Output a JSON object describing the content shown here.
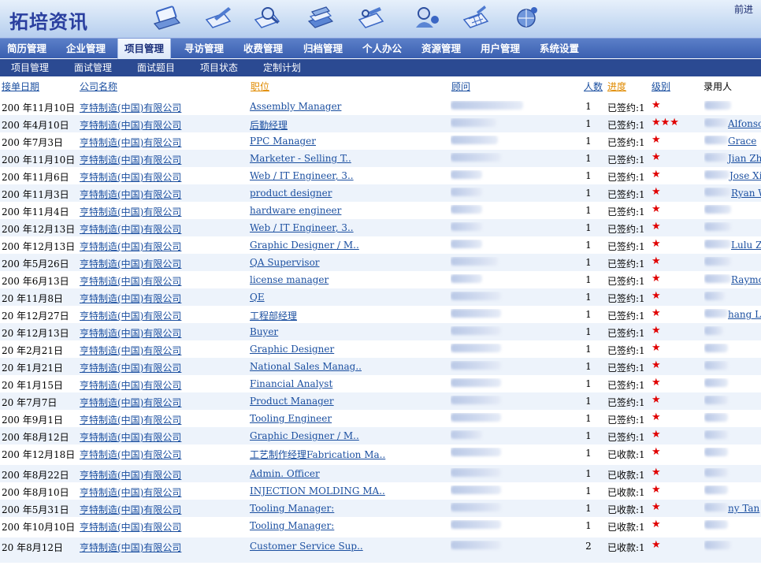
{
  "app": {
    "title": "拓培资讯",
    "top_link": "前进"
  },
  "top_icons": [
    "laptop-icon",
    "pen-document-icon",
    "search-document-icon",
    "books-icon",
    "document-tools-icon",
    "user-settings-icon",
    "calendar-icon",
    "globe-person-icon"
  ],
  "main_nav": [
    {
      "label": "简历管理"
    },
    {
      "label": "企业管理"
    },
    {
      "label": "项目管理"
    },
    {
      "label": "寻访管理"
    },
    {
      "label": "收费管理"
    },
    {
      "label": "归档管理"
    },
    {
      "label": "个人办公"
    },
    {
      "label": "资源管理"
    },
    {
      "label": "用户管理"
    },
    {
      "label": "系统设置"
    }
  ],
  "sub_nav": [
    {
      "label": "项目管理"
    },
    {
      "label": "面试管理"
    },
    {
      "label": "面试题目"
    },
    {
      "label": "项目状态"
    },
    {
      "label": "定制计划"
    }
  ],
  "columns": {
    "date": "接单日期",
    "company": "公司名称",
    "position": "职位",
    "consultant": "顾问",
    "count": "人数",
    "progress": "进度",
    "level": "级别",
    "recruiter": "录用人"
  },
  "rows": [
    {
      "date": "200 年11月10日",
      "company": "亨特制造(中国)有限公司",
      "position": "Assembly Manager",
      "count": "1",
      "status": "已签约:1",
      "level": "★",
      "recruiter": ""
    },
    {
      "date": "200 年4月10日",
      "company": "亨特制造(中国)有限公司",
      "position": "后勤经理",
      "count": "1",
      "status": "已签约:1",
      "level": "★★★",
      "recruiter": "Alfonso"
    },
    {
      "date": "200 年7月3日",
      "company": "亨特制造(中国)有限公司",
      "position": "PPC Manager",
      "count": "1",
      "status": "已签约:1",
      "level": "★",
      "recruiter": "Grace"
    },
    {
      "date": "200 年11月10日",
      "company": "亨特制造(中国)有限公司",
      "position": "Marketer - Selling T..",
      "count": "1",
      "status": "已签约:1",
      "level": "★",
      "recruiter": "Jian Zh"
    },
    {
      "date": "200 年11月6日",
      "company": "亨特制造(中国)有限公司",
      "position": "Web / IT Engineer, 3..",
      "count": "1",
      "status": "已签约:1",
      "level": "★",
      "recruiter": "Jose Xi"
    },
    {
      "date": "200 年11月3日",
      "company": "亨特制造(中国)有限公司",
      "position": "product designer",
      "count": "1",
      "status": "已签约:1",
      "level": "★",
      "recruiter": "Ryan W"
    },
    {
      "date": "200 年11月4日",
      "company": "亨特制造(中国)有限公司",
      "position": "hardware engineer",
      "count": "1",
      "status": "已签约:1",
      "level": "★",
      "recruiter": ""
    },
    {
      "date": "200 年12月13日",
      "company": "亨特制造(中国)有限公司",
      "position": "Web / IT Engineer, 3..",
      "count": "1",
      "status": "已签约:1",
      "level": "★",
      "recruiter": ""
    },
    {
      "date": "200 年12月13日",
      "company": "亨特制造(中国)有限公司",
      "position": "Graphic Designer / M..",
      "count": "1",
      "status": "已签约:1",
      "level": "★",
      "recruiter": "Lulu Zh"
    },
    {
      "date": "200 年5月26日",
      "company": "亨特制造(中国)有限公司",
      "position": "QA Supervisor",
      "count": "1",
      "status": "已签约:1",
      "level": "★",
      "recruiter": ""
    },
    {
      "date": "200 年6月13日",
      "company": "亨特制造(中国)有限公司",
      "position": "license manager",
      "count": "1",
      "status": "已签约:1",
      "level": "★",
      "recruiter": "Raymo"
    },
    {
      "date": "20 年11月8日",
      "company": "亨特制造(中国)有限公司",
      "position": "QE",
      "count": "1",
      "status": "已签约:1",
      "level": "★",
      "recruiter": ""
    },
    {
      "date": "20 年12月27日",
      "company": "亨特制造(中国)有限公司",
      "position": "工程部经理",
      "count": "1",
      "status": "已签约:1",
      "level": "★",
      "recruiter": "hang Li"
    },
    {
      "date": "20 年12月13日",
      "company": "亨特制造(中国)有限公司",
      "position": "Buyer",
      "count": "1",
      "status": "已签约:1",
      "level": "★",
      "recruiter": ""
    },
    {
      "date": "20 年2月21日",
      "company": "亨特制造(中国)有限公司",
      "position": "Graphic Designer",
      "count": "1",
      "status": "已签约:1",
      "level": "★",
      "recruiter": ""
    },
    {
      "date": "20 年1月21日",
      "company": "亨特制造(中国)有限公司",
      "position": "National Sales Manag..",
      "count": "1",
      "status": "已签约:1",
      "level": "★",
      "recruiter": ""
    },
    {
      "date": "20 年1月15日",
      "company": "亨特制造(中国)有限公司",
      "position": "Financial Analyst",
      "count": "1",
      "status": "已签约:1",
      "level": "★",
      "recruiter": ""
    },
    {
      "date": "20 年7月7日",
      "company": "亨特制造(中国)有限公司",
      "position": "Product Manager",
      "count": "1",
      "status": "已签约:1",
      "level": "★",
      "recruiter": ""
    },
    {
      "date": "200 年9月1日",
      "company": "亨特制造(中国)有限公司",
      "position": "Tooling Engineer",
      "count": "1",
      "status": "已签约:1",
      "level": "★",
      "recruiter": ""
    },
    {
      "date": "200 年8月12日",
      "company": "亨特制造(中国)有限公司",
      "position": "Graphic Designer / M..",
      "count": "1",
      "status": "已签约:1",
      "level": "★",
      "recruiter": ""
    },
    {
      "date": "200 年12月18日",
      "company": "亨特制造(中国)有限公司",
      "position": "工艺制作经理Fabrication Ma..",
      "count": "1",
      "status": "已收款:1",
      "level": "★",
      "recruiter": ""
    },
    {
      "date": "200 年8月22日",
      "company": "亨特制造(中国)有限公司",
      "position": "Admin. Officer",
      "count": "1",
      "status": "已收款:1",
      "level": "★",
      "recruiter": ""
    },
    {
      "date": "200 年8月10日",
      "company": "亨特制造(中国)有限公司",
      "position": "INJECTION MOLDING MA..",
      "count": "1",
      "status": "已收款:1",
      "level": "★",
      "recruiter": ""
    },
    {
      "date": "200 年5月31日",
      "company": "亨特制造(中国)有限公司",
      "position": "Tooling Manager:",
      "count": "1",
      "status": "已收款:1",
      "level": "★",
      "recruiter": "ny Tan"
    },
    {
      "date": "200 年10月10日",
      "company": "亨特制造(中国)有限公司",
      "position": "Tooling Manager:",
      "count": "1",
      "status": "已收款:1",
      "level": "★",
      "recruiter": ""
    },
    {
      "date": "20 年8月12日",
      "company": "亨特制造(中国)有限公司",
      "position": "Customer Service Sup..",
      "count": "2",
      "status": "已收款:1",
      "level": "★",
      "recruiter": ""
    }
  ]
}
